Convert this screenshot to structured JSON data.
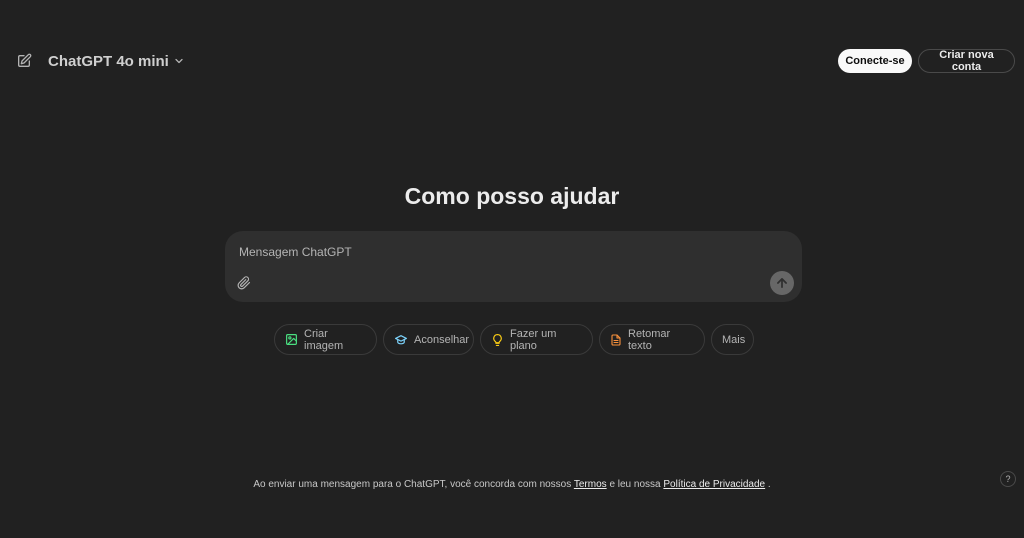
{
  "header": {
    "model_label": "ChatGPT 4o mini",
    "login_label": "Conecte-se",
    "signup_label": "Criar nova conta"
  },
  "main": {
    "title": "Como posso ajudar",
    "composer_placeholder": "Mensagem ChatGPT"
  },
  "chips": [
    {
      "label": "Criar imagem",
      "icon": "image-icon",
      "color": "#4ade80"
    },
    {
      "label": "Aconselhar",
      "icon": "graduation-cap-icon",
      "color": "#7dd3fc"
    },
    {
      "label": "Fazer um plano",
      "icon": "lightbulb-icon",
      "color": "#facc15"
    },
    {
      "label": "Retomar texto",
      "icon": "document-icon",
      "color": "#fb923c"
    },
    {
      "label": "Mais",
      "icon": "",
      "color": ""
    }
  ],
  "footer": {
    "text_before": "Ao enviar uma mensagem para o ChatGPT, você concorda com nossos",
    "terms_label": "Termos",
    "text_middle": "e leu nossa",
    "privacy_label": "Política de Privacidade",
    "text_after": ".",
    "help_label": "?"
  }
}
